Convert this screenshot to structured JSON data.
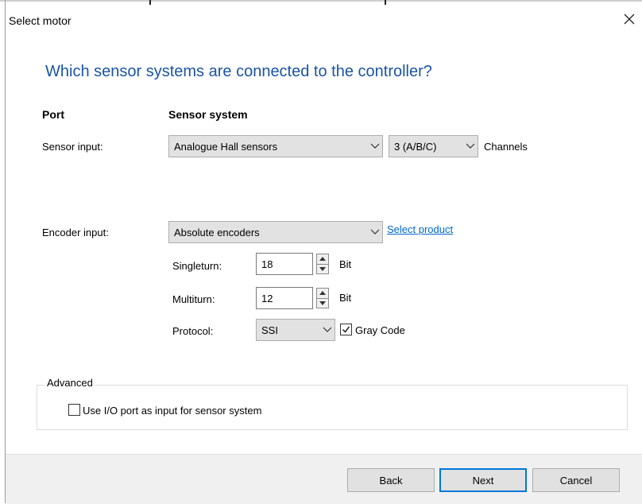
{
  "dialog": {
    "title": "Select motor",
    "close_glyph": "✕",
    "heading": "Which sensor systems are connected to the controller?"
  },
  "columns": {
    "port": "Port",
    "sensor_system": "Sensor system"
  },
  "sensor_input": {
    "label": "Sensor input:",
    "system_value": "Analogue Hall sensors",
    "channels_value": "3 (A/B/C)",
    "channels_suffix": "Channels"
  },
  "encoder_input": {
    "label": "Encoder input:",
    "type_value": "Absolute encoders",
    "select_product_link": "Select product",
    "singleturn": {
      "label": "Singleturn:",
      "value": "18",
      "unit": "Bit"
    },
    "multiturn": {
      "label": "Multiturn:",
      "value": "12",
      "unit": "Bit"
    },
    "protocol": {
      "label": "Protocol:",
      "value": "SSI"
    },
    "gray_code": {
      "label": "Gray Code",
      "checked": true
    }
  },
  "advanced": {
    "legend": "Advanced",
    "use_io_port": {
      "label": "Use I/O port as input for sensor system",
      "checked": false
    }
  },
  "buttons": {
    "back": "Back",
    "next": "Next",
    "cancel": "Cancel"
  },
  "icons": {
    "chevron": "chevron-down-icon",
    "spin_up": "spin-up-icon",
    "spin_down": "spin-down-icon",
    "check": "checkmark-icon",
    "close": "close-icon"
  },
  "colors": {
    "heading": "#1a54a6",
    "link": "#0066cc",
    "primary_button_border": "#0078d7",
    "footer_background": "#f0f0f0"
  }
}
